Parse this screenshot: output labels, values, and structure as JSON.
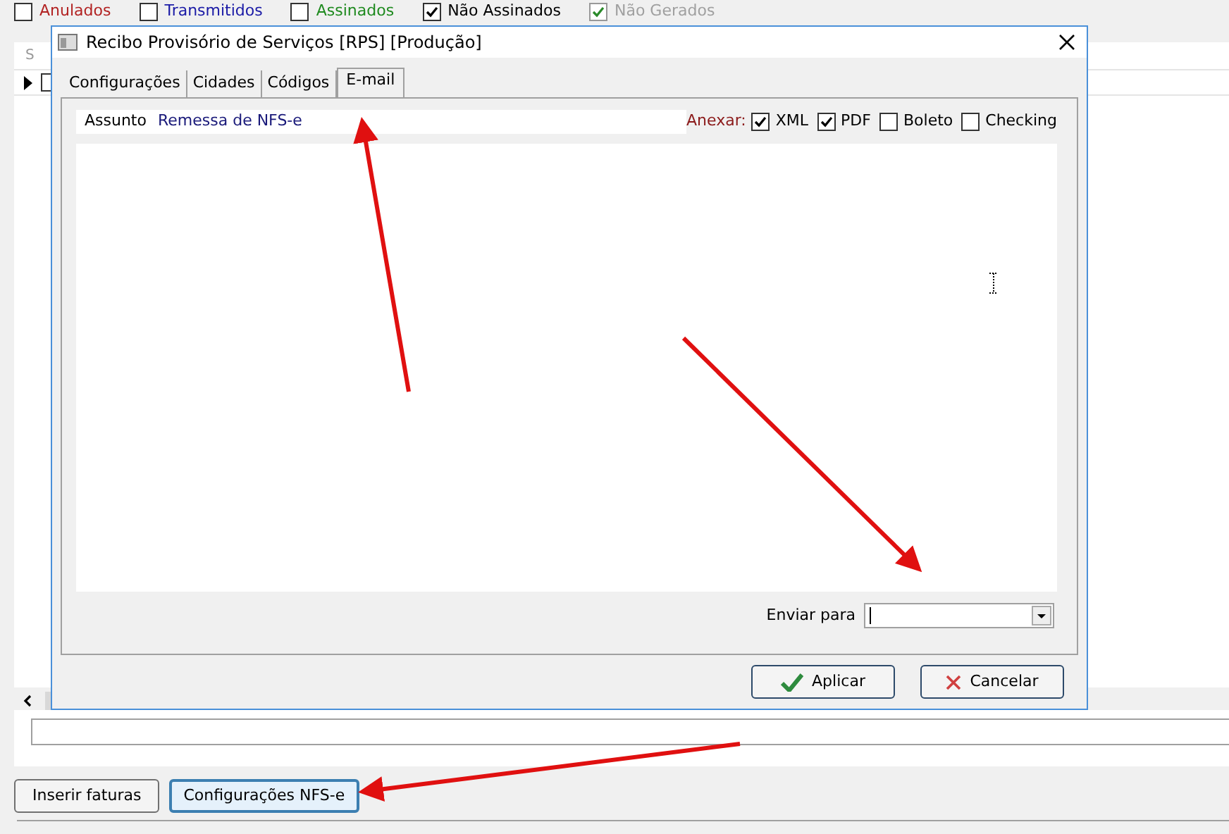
{
  "filters": [
    {
      "label": "Anulados",
      "checked": false,
      "color": "#b22222",
      "disabled": false
    },
    {
      "label": "Transmitidos",
      "checked": false,
      "color": "#1a1aa6",
      "disabled": false
    },
    {
      "label": "Assinados",
      "checked": false,
      "color": "#1f8a1f",
      "disabled": false
    },
    {
      "label": "Não Assinados",
      "checked": true,
      "color": "#000000",
      "disabled": false
    },
    {
      "label": "Não Gerados",
      "checked": true,
      "color": "#a0a0a0",
      "disabled": true
    }
  ],
  "grid": {
    "column_1": "S",
    "rows": [
      {
        "selected": true,
        "checked": false
      }
    ]
  },
  "dialog": {
    "title": "Recibo Provisório de Serviços [RPS] [Produção]",
    "tabs": [
      {
        "label": "Configurações",
        "selected": false
      },
      {
        "label": "Cidades",
        "selected": false
      },
      {
        "label": "Códigos",
        "selected": false
      },
      {
        "label": "E-mail",
        "selected": true
      }
    ],
    "subject": {
      "label": "Assunto",
      "value": "Remessa de NFS-e"
    },
    "attach": {
      "label": "Anexar:",
      "options": [
        {
          "label": "XML",
          "checked": true
        },
        {
          "label": "PDF",
          "checked": true
        },
        {
          "label": "Boleto",
          "checked": false
        },
        {
          "label": "Checking",
          "checked": false
        }
      ]
    },
    "send_to": {
      "label": "Enviar para"
    },
    "buttons": [
      {
        "label": "Aplicar",
        "kind": "ok"
      },
      {
        "label": "Cancelar",
        "kind": "cancel"
      }
    ]
  },
  "buttons": [
    {
      "label": "Inserir faturas",
      "selected": false
    },
    {
      "label": "Configurações NFS-e",
      "selected": true
    }
  ]
}
